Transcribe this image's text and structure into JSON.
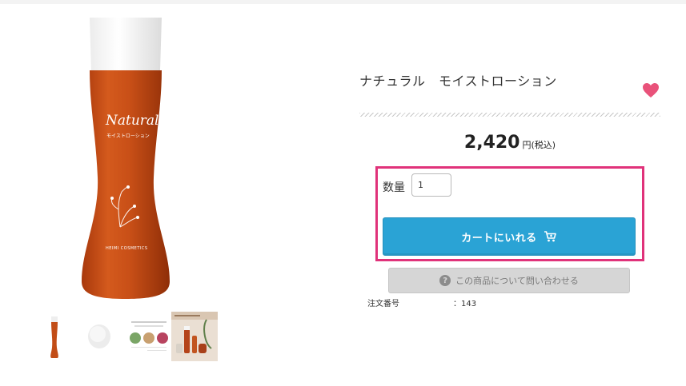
{
  "product": {
    "brand_on_bottle": "Natural",
    "bottle_subtitle": "モイストローション",
    "bottle_maker": "HEIMI COSMETICS",
    "title": "ナチュラル　モイストローション",
    "price": "2,420",
    "price_suffix": "円(税込)"
  },
  "purchase": {
    "qty_label": "数量",
    "qty_value": "1",
    "cart_button_label": "カートにいれる",
    "inquire_button_label": "この商品について問い合わせる"
  },
  "meta": {
    "order_no_label": "注文番号",
    "order_no_value": "：143"
  },
  "thumbnails": [
    {
      "name": "bottle"
    },
    {
      "name": "lotion-drop"
    },
    {
      "name": "ingredients-infographic"
    },
    {
      "name": "product-lineup-banner"
    }
  ],
  "colors": {
    "accent_cart": "#2aa3d5",
    "highlight_border": "#e0327a",
    "favorite_heart": "#e9527a",
    "bottle_amber": "#c24d17"
  },
  "icons": {
    "favorite": "heart-icon",
    "cart": "cart-icon",
    "question": "question-circle-icon"
  }
}
